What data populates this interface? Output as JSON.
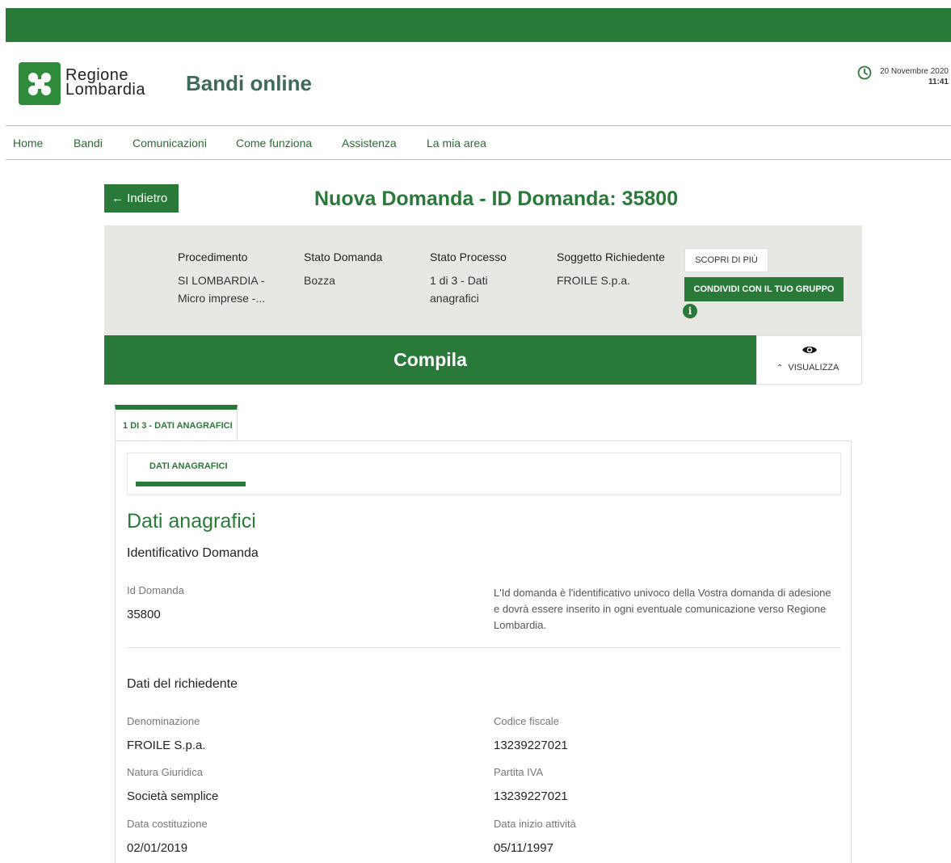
{
  "header": {
    "logo_line1": "Regione",
    "logo_line2": "Lombardia",
    "site_title": "Bandi online",
    "date": "20 Novembre 2020",
    "time": "11:41"
  },
  "nav": {
    "items": [
      "Home",
      "Bandi",
      "Comunicazioni",
      "Come funziona",
      "Assistenza",
      "La mia area"
    ]
  },
  "page": {
    "back_label": "← Indietro",
    "title": "Nuova Domanda - ID Domanda: 35800"
  },
  "info_panel": {
    "procedimento_label": "Procedimento",
    "procedimento_value": "SI LOMBARDIA - Micro imprese -...",
    "stato_domanda_label": "Stato Domanda",
    "stato_domanda_value": "Bozza",
    "stato_processo_label": "Stato Processo",
    "stato_processo_value": "1 di 3 - Dati anagrafici",
    "soggetto_label": "Soggetto Richiedente",
    "soggetto_value": "FROILE S.p.a.",
    "scopri_label": "SCOPRI DI PIÙ",
    "condividi_label": "CONDIVIDI CON IL TUO GRUPPO"
  },
  "compila": {
    "label": "Compila",
    "visualizza_label": "VISUALIZZA"
  },
  "steps": {
    "active_tab": "1 DI 3 - DATI ANAGRAFICI",
    "sub_tab": "DATI ANAGRAFICI"
  },
  "form": {
    "section_title": "Dati anagrafici",
    "id_group_title": "Identificativo Domanda",
    "id_label": "Id Domanda",
    "id_value": "35800",
    "id_note": "L'Id domanda è l'identificativo univoco della Vostra domanda di adesione e dovrà essere inserito in ogni eventuale comunicazione verso Regione Lombardia.",
    "richiedente_title": "Dati del richiedente",
    "denominazione_label": "Denominazione",
    "denominazione_value": "FROILE S.p.a.",
    "codice_fiscale_label": "Codice fiscale",
    "codice_fiscale_value": "13239227021",
    "natura_label": "Natura Giuridica",
    "natura_value": "Società semplice",
    "partita_iva_label": "Partita IVA",
    "partita_iva_value": "13239227021",
    "data_costituzione_label": "Data costituzione",
    "data_costituzione_value": "02/01/2019",
    "data_inizio_label": "Data inizio attività",
    "data_inizio_value": "05/11/1997"
  },
  "colors": {
    "primary_green": "#297a38",
    "panel_gray": "#e7e7e4"
  }
}
